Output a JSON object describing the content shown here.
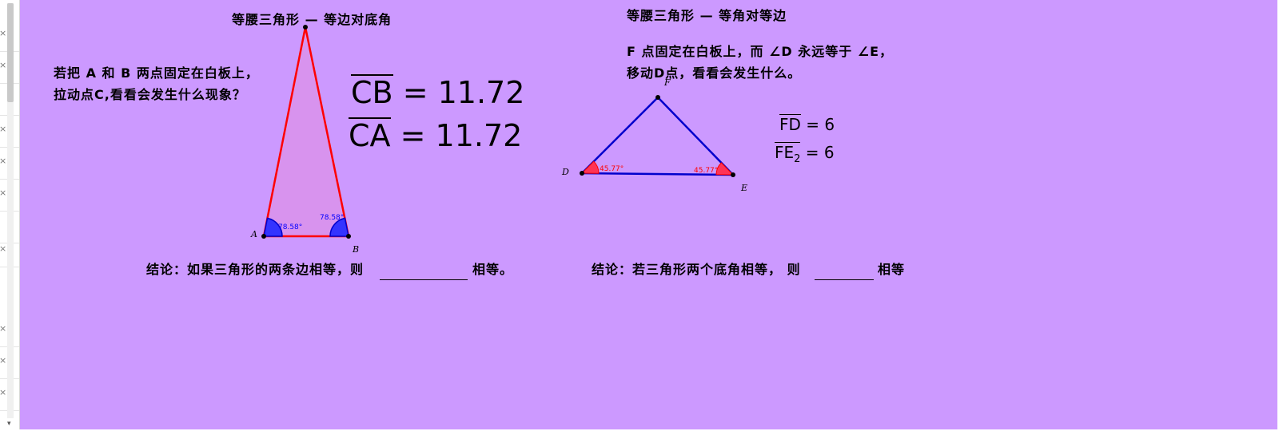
{
  "left_panel": {
    "close_glyph": "×",
    "scroll_down_glyph": "▾"
  },
  "construction1": {
    "title": "等腰三角形 — 等边对底角",
    "instruction_line1": "若把 A 和 B 两点固定在白板上，",
    "instruction_line2": "拉动点C,看看会发生什么现象？",
    "segment_CB_label": "CB",
    "segment_CB_value": "= 11.72",
    "segment_CA_label": "CA",
    "segment_CA_value": "= 11.72",
    "point_A": "A",
    "point_B": "B",
    "angle_A": "78.58°",
    "angle_B": "78.58°",
    "conclusion_prefix": "结论：如果三角形的两条边相等，则",
    "conclusion_suffix": "相等。",
    "triangle_stroke": "#ff0000",
    "angle_color": "#0000ff"
  },
  "construction2": {
    "title": "等腰三角形 — 等角对等边",
    "instruction_line1": "F 点固定在白板上，而 ∠D 永远等于 ∠E，",
    "instruction_line2": "移动D点，看看会发生什么。",
    "segment_FD_label": "FD",
    "segment_FD_value": "= 6",
    "segment_FE_label": "FE",
    "segment_FE_subscript": "2",
    "segment_FE_value": "= 6",
    "point_D": "D",
    "point_E": "E",
    "point_F": "F",
    "angle_D": "45.77°",
    "angle_E": "45.77°",
    "conclusion_prefix": "结论：若三角形两个底角相等， 则",
    "conclusion_suffix": "相等",
    "triangle_stroke": "#0000cc",
    "angle_color": "#ff0000"
  },
  "colors": {
    "canvas_background": "#cc99ff"
  }
}
